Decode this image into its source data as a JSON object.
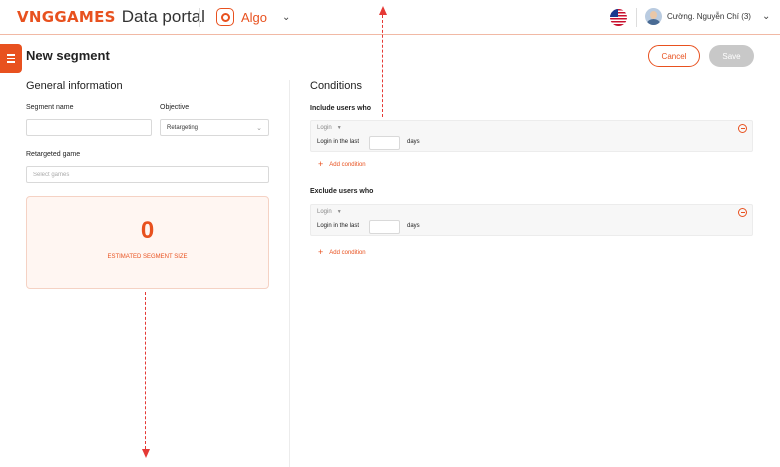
{
  "header": {
    "brand": "VNGGAMES",
    "portal": "Data portal",
    "app_name": "Algo",
    "language_flag": "us-flag-icon",
    "user_name": "Cường. Nguyễn Chí (3)"
  },
  "page": {
    "title": "New segment",
    "cancel_label": "Cancel",
    "save_label": "Save"
  },
  "general": {
    "title": "General information",
    "segment_name_label": "Segment name",
    "segment_name_value": "",
    "objective_label": "Objective",
    "objective_value": "Retargeting",
    "game_label": "Retargeted game",
    "game_placeholder": "Select games",
    "estimate_value": "0",
    "estimate_label": "ESTIMATED SEGMENT SIZE"
  },
  "conditions": {
    "title": "Conditions",
    "include": {
      "heading": "Include users who",
      "type": "Login",
      "text": "Login in the last",
      "days_value": "",
      "unit": "days",
      "add_label": "Add condition"
    },
    "exclude": {
      "heading": "Exclude users who",
      "type": "Login",
      "text": "Login in the last",
      "days_value": "",
      "unit": "days",
      "add_label": "Add condition"
    }
  },
  "colors": {
    "accent": "#e8511f",
    "annotation": "#e53935",
    "disabled": "#c8c8c8"
  }
}
